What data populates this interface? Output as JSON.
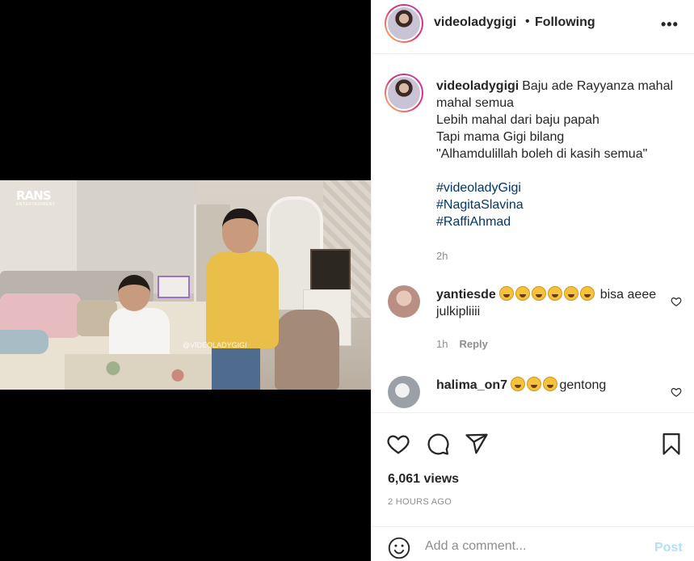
{
  "video": {
    "channel_logo": "RANS",
    "channel_logo_sub": "ENTERTAINMENT",
    "watermark": "@VIDEOLADYGIGI"
  },
  "header": {
    "username": "videoladygigi",
    "separator": "•",
    "follow_status": "Following",
    "more_icon": "more-horizontal-icon",
    "more_label": "•••"
  },
  "caption": {
    "username": "videoladygigi",
    "lines": [
      "Baju ade Rayyanza mahal",
      "mahal semua",
      "Lebih mahal dari baju papah",
      "Tapi mama Gigi bilang",
      "\"Alhamdulillah boleh di kasih semua\""
    ],
    "hashtags": [
      "#videoladyGigi",
      "#NagitaSlavina",
      "#RaffiAhmad"
    ],
    "time": "2h"
  },
  "comments": [
    {
      "username": "yantiesde",
      "emoji_count": 6,
      "text_after": "bisa aeee julkipliiii",
      "time": "1h",
      "reply_label": "Reply"
    },
    {
      "username": "halima_on7",
      "emoji_count": 3,
      "text_after": "gentong"
    }
  ],
  "actions": {
    "like_icon": "heart-icon",
    "comment_icon": "comment-icon",
    "share_icon": "paper-plane-icon",
    "save_icon": "bookmark-icon",
    "views": "6,061 views",
    "post_time": "2 HOURS AGO"
  },
  "add_comment": {
    "placeholder": "Add a comment...",
    "post_label": "Post",
    "emoji_icon": "smiley-icon"
  },
  "colors": {
    "link": "#00376b",
    "muted": "#8e8e8e",
    "post_disabled": "#b2dffc"
  }
}
